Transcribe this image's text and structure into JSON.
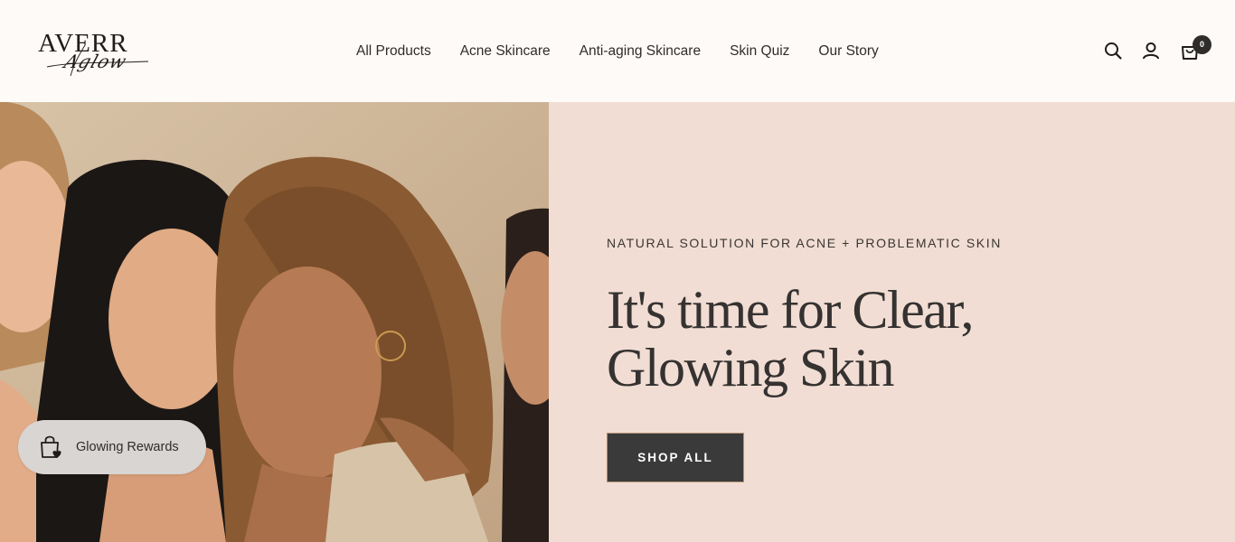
{
  "brand": {
    "logo_main": "AVERR",
    "logo_script": "Aglow"
  },
  "nav": {
    "items": [
      {
        "label": "All Products"
      },
      {
        "label": "Acne Skincare"
      },
      {
        "label": "Anti-aging Skincare"
      },
      {
        "label": "Skin Quiz"
      },
      {
        "label": "Our Story"
      }
    ]
  },
  "header_icons": {
    "search": "search-icon",
    "account": "user-icon",
    "cart": "shopping-bag-icon"
  },
  "cart": {
    "count": "0"
  },
  "hero": {
    "eyebrow": "NATURAL SOLUTION FOR ACNE + PROBLEMATIC SKIN",
    "headline_line1": "It's time for Clear,",
    "headline_line2": "Glowing Skin",
    "cta_label": "SHOP ALL"
  },
  "rewards": {
    "label": "Glowing Rewards",
    "icon": "shopping-bag-heart-icon"
  },
  "colors": {
    "header_bg": "#fefaf7",
    "hero_panel_bg": "#f1ddd3",
    "button_bg": "#3b3a3b",
    "button_border": "#b48f73",
    "text_dark": "#2f2d2c"
  }
}
